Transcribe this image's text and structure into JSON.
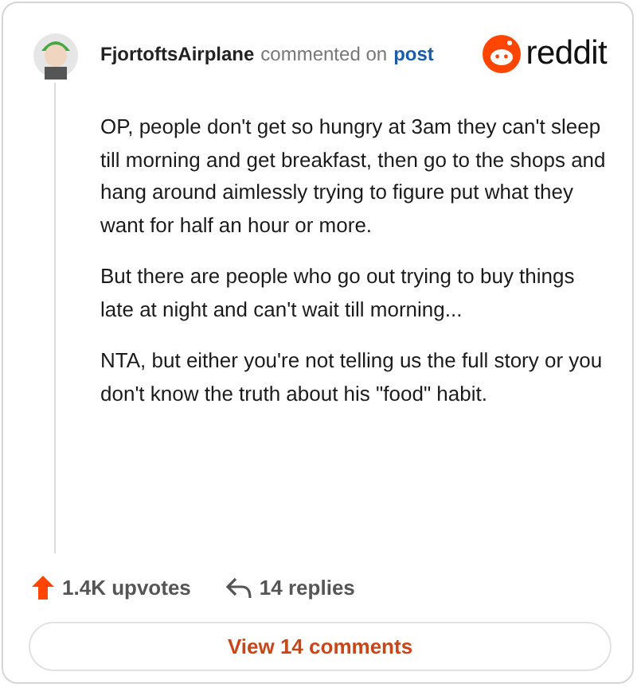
{
  "comment": {
    "author": "FjortoftsAirplane",
    "action": "commented on",
    "link": "post",
    "paragraphs": [
      "OP, people don't get so hungry at 3am they can't sleep till morning and get breakfast, then go to the shops and hang around aimlessly trying to figure put what they want for half an hour or more.",
      "But there are people who go out trying to buy things late at night and can't wait till morning...",
      "NTA, but either you're not telling us the full story or you don't know the truth about his \"food\" habit."
    ]
  },
  "brand": {
    "wordmark": "reddit"
  },
  "stats": {
    "upvotes": "1.4K upvotes",
    "replies": "14 replies"
  },
  "button": {
    "label": "View 14 comments"
  }
}
